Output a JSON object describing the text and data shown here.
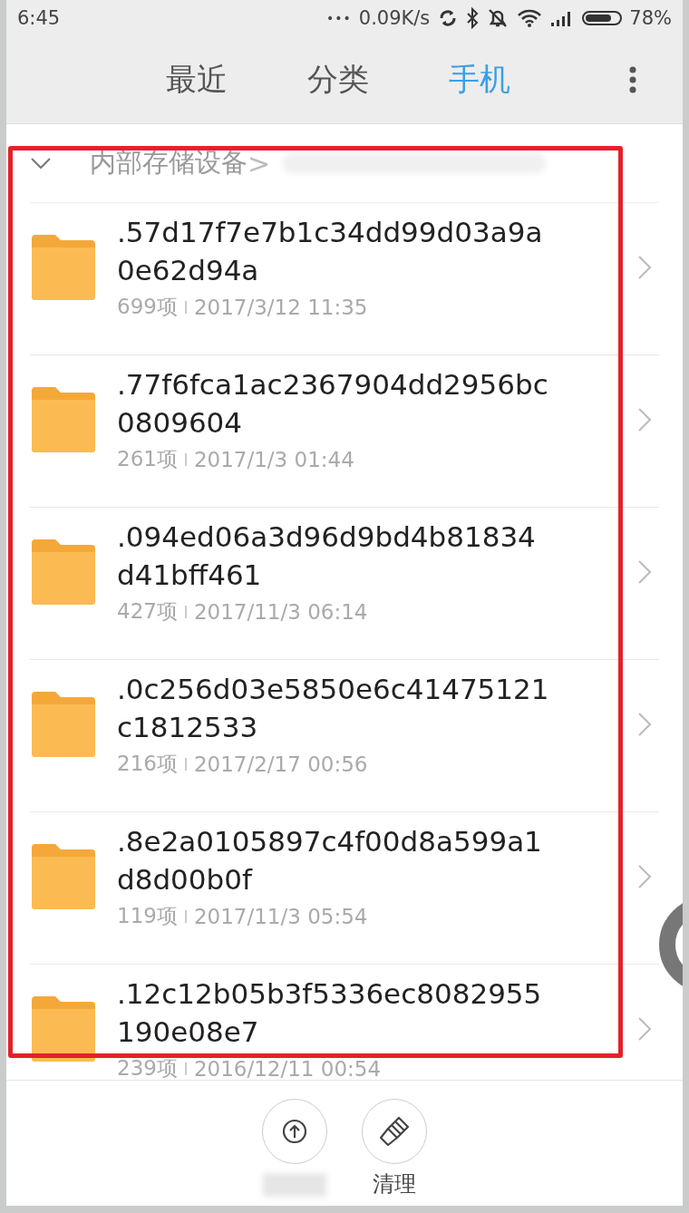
{
  "status_bar": {
    "time": "6:45",
    "dots": "•••",
    "speed": "0.09K/s",
    "battery": "78%"
  },
  "tabs": [
    {
      "label": "最近",
      "selected": false
    },
    {
      "label": "分类",
      "selected": false
    },
    {
      "label": "手机",
      "selected": true
    }
  ],
  "breadcrumb": {
    "root": "内部存储设备",
    "separator": ">"
  },
  "folders": [
    {
      "name": ".57d17f7e7b1c34dd99d03a9a0e62d94a",
      "count": "699项",
      "date": "2017/3/12 11:35"
    },
    {
      "name": ".77f6fca1ac2367904dd2956bc0809604",
      "count": "261项",
      "date": "2017/1/3 01:44"
    },
    {
      "name": ".094ed06a3d96d9bd4b81834d41bff461",
      "count": "427项",
      "date": "2017/11/3 06:14"
    },
    {
      "name": ".0c256d03e5850e6c41475121c1812533",
      "count": "216项",
      "date": "2017/2/17 00:56"
    },
    {
      "name": ".8e2a0105897c4f00d8a599a1d8d00b0f",
      "count": "119项",
      "date": "2017/11/3 05:54"
    },
    {
      "name": ".12c12b05b3f5336ec8082955190e08e7",
      "count": "239项",
      "date": "2016/12/11 00:54"
    }
  ],
  "bottom_actions": [
    {
      "kind": "upload"
    },
    {
      "kind": "clean",
      "label": "清理"
    }
  ]
}
